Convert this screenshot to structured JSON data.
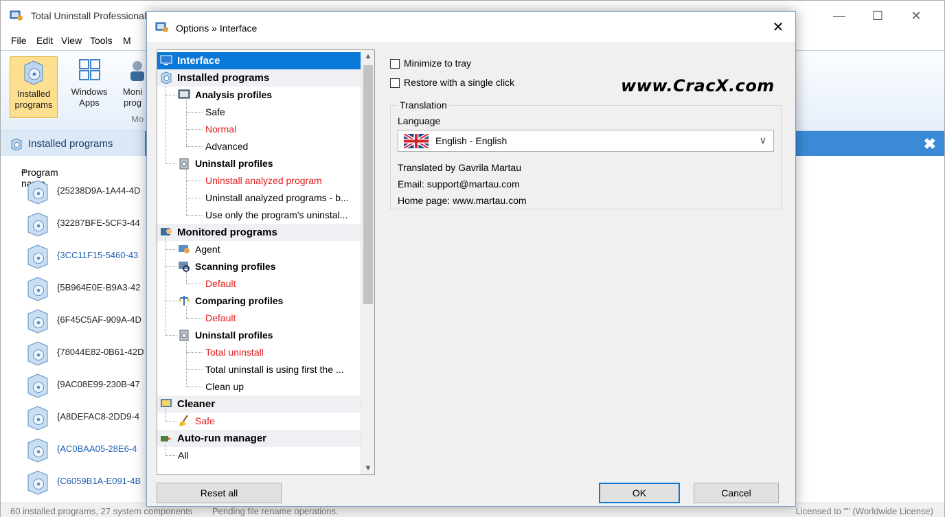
{
  "main_window": {
    "title": "Total Uninstall Professional",
    "menu": [
      "File",
      "Edit",
      "View",
      "Tools",
      "M"
    ],
    "ribbon": {
      "buttons": [
        {
          "line1": "Installed",
          "line2": "programs",
          "active": true
        },
        {
          "line1": "Windows",
          "line2": "Apps",
          "active": false
        },
        {
          "line1": "Moni",
          "line2": "prog",
          "active": false
        }
      ],
      "group_label": "Mo"
    },
    "panel_header": "Installed programs",
    "column_header": "Program name",
    "sort_indicator": "^",
    "programs": [
      {
        "name": "{25238D9A-1A44-4D",
        "color": "#222222"
      },
      {
        "name": "{32287BFE-5CF3-44",
        "color": "#222222"
      },
      {
        "name": "{3CC11F15-5460-43",
        "color": "#1f5fb4"
      },
      {
        "name": "{5B964E0E-B9A3-42",
        "color": "#222222"
      },
      {
        "name": "{6F45C5AF-909A-4D",
        "color": "#222222"
      },
      {
        "name": "{78044E82-0B61-42D",
        "color": "#222222"
      },
      {
        "name": "{9AC08E99-230B-47",
        "color": "#222222"
      },
      {
        "name": "{A8DEFAC8-2DD9-4",
        "color": "#222222"
      },
      {
        "name": "{AC0BAA05-28E6-4",
        "color": "#1f5fb4"
      },
      {
        "name": "{C6059B1A-E091-4B",
        "color": "#1f5fb4"
      }
    ],
    "status_left": "60 installed programs, 27 system components",
    "status_middle": "Pending file rename operations.",
    "status_right": "Licensed to \"\" (Worldwide License)"
  },
  "dialog": {
    "title": "Options » Interface",
    "tree": [
      {
        "label": "Interface",
        "level": 0,
        "selected": true,
        "icon": "monitor-icon"
      },
      {
        "label": "Installed programs",
        "level": 0,
        "icon": "cd-box-icon"
      },
      {
        "label": "Analysis profiles",
        "level": 1,
        "icon": "analysis-icon"
      },
      {
        "label": "Safe",
        "level": 2
      },
      {
        "label": "Normal",
        "level": 2,
        "red": true
      },
      {
        "label": "Advanced",
        "level": 2
      },
      {
        "label": "Uninstall profiles",
        "level": 1,
        "icon": "trash-icon"
      },
      {
        "label": "Uninstall analyzed program",
        "level": 2,
        "red": true
      },
      {
        "label": "Uninstall analyzed programs - b...",
        "level": 2
      },
      {
        "label": "Use only the program's uninstal...",
        "level": 2
      },
      {
        "label": "Monitored programs",
        "level": 0,
        "icon": "monitor-people-icon"
      },
      {
        "label": "Agent",
        "level": 1,
        "icon": "agent-icon",
        "plain": true
      },
      {
        "label": "Scanning profiles",
        "level": 1,
        "icon": "scan-icon"
      },
      {
        "label": "Default",
        "level": 2,
        "red": true
      },
      {
        "label": "Comparing profiles",
        "level": 1,
        "icon": "scales-icon"
      },
      {
        "label": "Default",
        "level": 2,
        "red": true
      },
      {
        "label": "Uninstall profiles",
        "level": 1,
        "icon": "trash-icon"
      },
      {
        "label": "Total uninstall",
        "level": 2,
        "red": true
      },
      {
        "label": "Total uninstall is using first the ...",
        "level": 2
      },
      {
        "label": "Clean up",
        "level": 2
      },
      {
        "label": "Cleaner",
        "level": 0,
        "icon": "cleaner-icon"
      },
      {
        "label": "Safe",
        "level": 1,
        "red": true,
        "icon": "broom-icon",
        "plain": true
      },
      {
        "label": "Auto-run manager",
        "level": 0,
        "icon": "autorun-icon"
      },
      {
        "label": "All",
        "level": 1,
        "plain": true
      }
    ],
    "options": {
      "minimize_to_tray": {
        "label": "Minimize to tray",
        "checked": false
      },
      "restore_single_click": {
        "label": "Restore with a single click",
        "checked": false
      }
    },
    "watermark": "www.CracX.com",
    "translation": {
      "group_title": "Translation",
      "language_label": "Language",
      "language_value": "English - English",
      "translated_by": "Translated by Gavrila Martau",
      "email": "Email: support@martau.com",
      "home_page": "Home page: www.martau.com"
    },
    "buttons": {
      "reset": "Reset all",
      "ok": "OK",
      "cancel": "Cancel"
    }
  },
  "colors": {
    "selection": "#0a78d7",
    "red_item": "#e31c1c",
    "panel_header": "#3b8ad8",
    "active_ribbon": "#fddf90"
  }
}
